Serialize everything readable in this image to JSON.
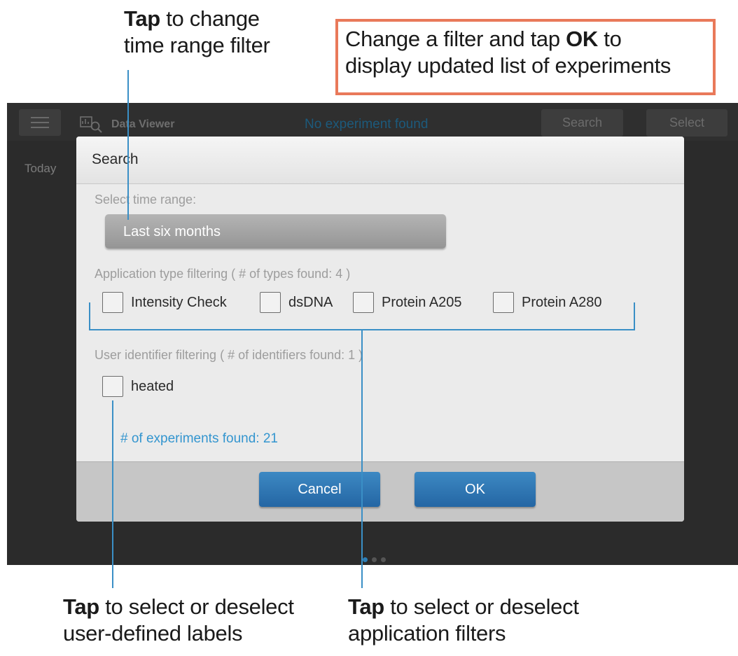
{
  "annotations": {
    "time_range": {
      "bold": "Tap",
      "rest1": " to change",
      "line2": "time range filter"
    },
    "ok_box": {
      "line1_pre": "Change a filter and tap ",
      "line1_bold": "OK",
      "line1_post": " to",
      "line2": "display updated list of experiments"
    },
    "user_labels": {
      "bold": "Tap",
      "rest1": " to select or deselect",
      "line2": "user-defined labels"
    },
    "app_filters": {
      "bold": "Tap",
      "rest1": " to select or deselect",
      "line2": "application filters"
    }
  },
  "topbar": {
    "title": "Data Viewer",
    "status": "No experiment found",
    "search_label": "Search",
    "select_label": "Select"
  },
  "sidebar": {
    "today": "Today"
  },
  "dialog": {
    "title": "Search",
    "time_range_label": "Select time range:",
    "time_range_value": "Last six months",
    "app_filter_label": "Application type filtering ( # of types found: 4 )",
    "app_types": [
      "Intensity Check",
      "dsDNA",
      "Protein A205",
      "Protein A280"
    ],
    "user_filter_label": "User identifier filtering ( # of identifiers found: 1 )",
    "user_ids": [
      "heated"
    ],
    "experiments_found": "# of experiments found: 21",
    "cancel_label": "Cancel",
    "ok_label": "OK"
  },
  "colors": {
    "accent": "#3395cf",
    "button": "#2b72ae",
    "callout_border": "#e9795a",
    "leader_line": "#3a8fc6"
  }
}
